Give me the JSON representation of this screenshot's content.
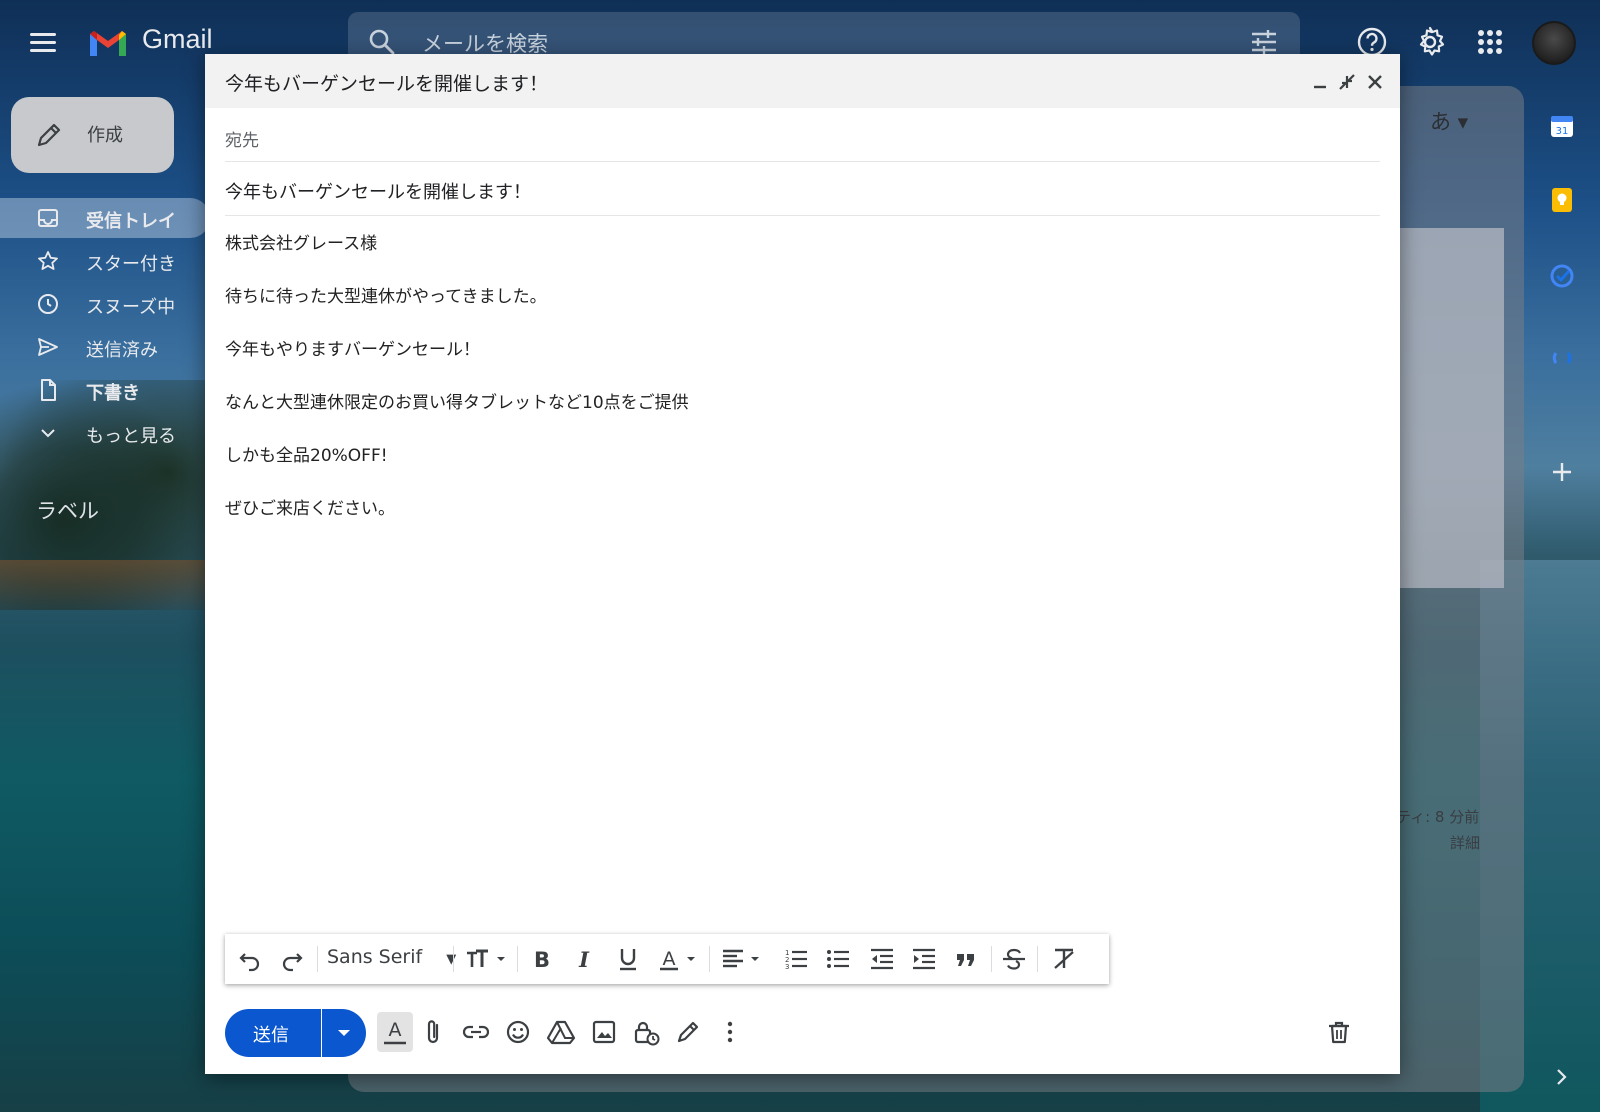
{
  "app": {
    "name": "Gmail",
    "colors": {
      "accent": "#0b57d0",
      "logo_red": "#ea4335",
      "logo_blue": "#4285f4",
      "logo_green": "#34a853",
      "logo_yellow": "#fbbc04"
    }
  },
  "topbar": {
    "search_placeholder": "メールを検索",
    "icons": [
      "menu-icon",
      "search-icon",
      "search-options-icon",
      "help-icon",
      "settings-icon",
      "apps-icon"
    ]
  },
  "sidebar": {
    "compose_label": "作成",
    "items": [
      {
        "label": "受信トレイ",
        "icon": "inbox-icon"
      },
      {
        "label": "スター付き",
        "icon": "star-icon"
      },
      {
        "label": "スヌーズ中",
        "icon": "clock-icon"
      },
      {
        "label": "送信済み",
        "icon": "send-icon"
      },
      {
        "label": "下書き",
        "icon": "draft-icon"
      },
      {
        "label": "もっと見る",
        "icon": "chevron-down-icon"
      }
    ],
    "labels_heading": "ラベル"
  },
  "background": {
    "input_tool": "あ",
    "activity": "ティ: 8 分前",
    "details": "詳細"
  },
  "compose": {
    "window_title": "今年もバーゲンセールを開催します！",
    "to_label": "宛先",
    "subject": "今年もバーゲンセールを開催します！",
    "body_lines": [
      "株式会社グレース様",
      "待ちに待った大型連休がやってきました。",
      "今年もやりますバーゲンセール！",
      "なんと大型連休限定のお買い得タブレットなど10点をご提供",
      "しかも全品20%OFF!",
      "ぜひご来店ください。"
    ],
    "toolbar": {
      "font": "Sans Serif"
    },
    "send_label": "送信"
  }
}
